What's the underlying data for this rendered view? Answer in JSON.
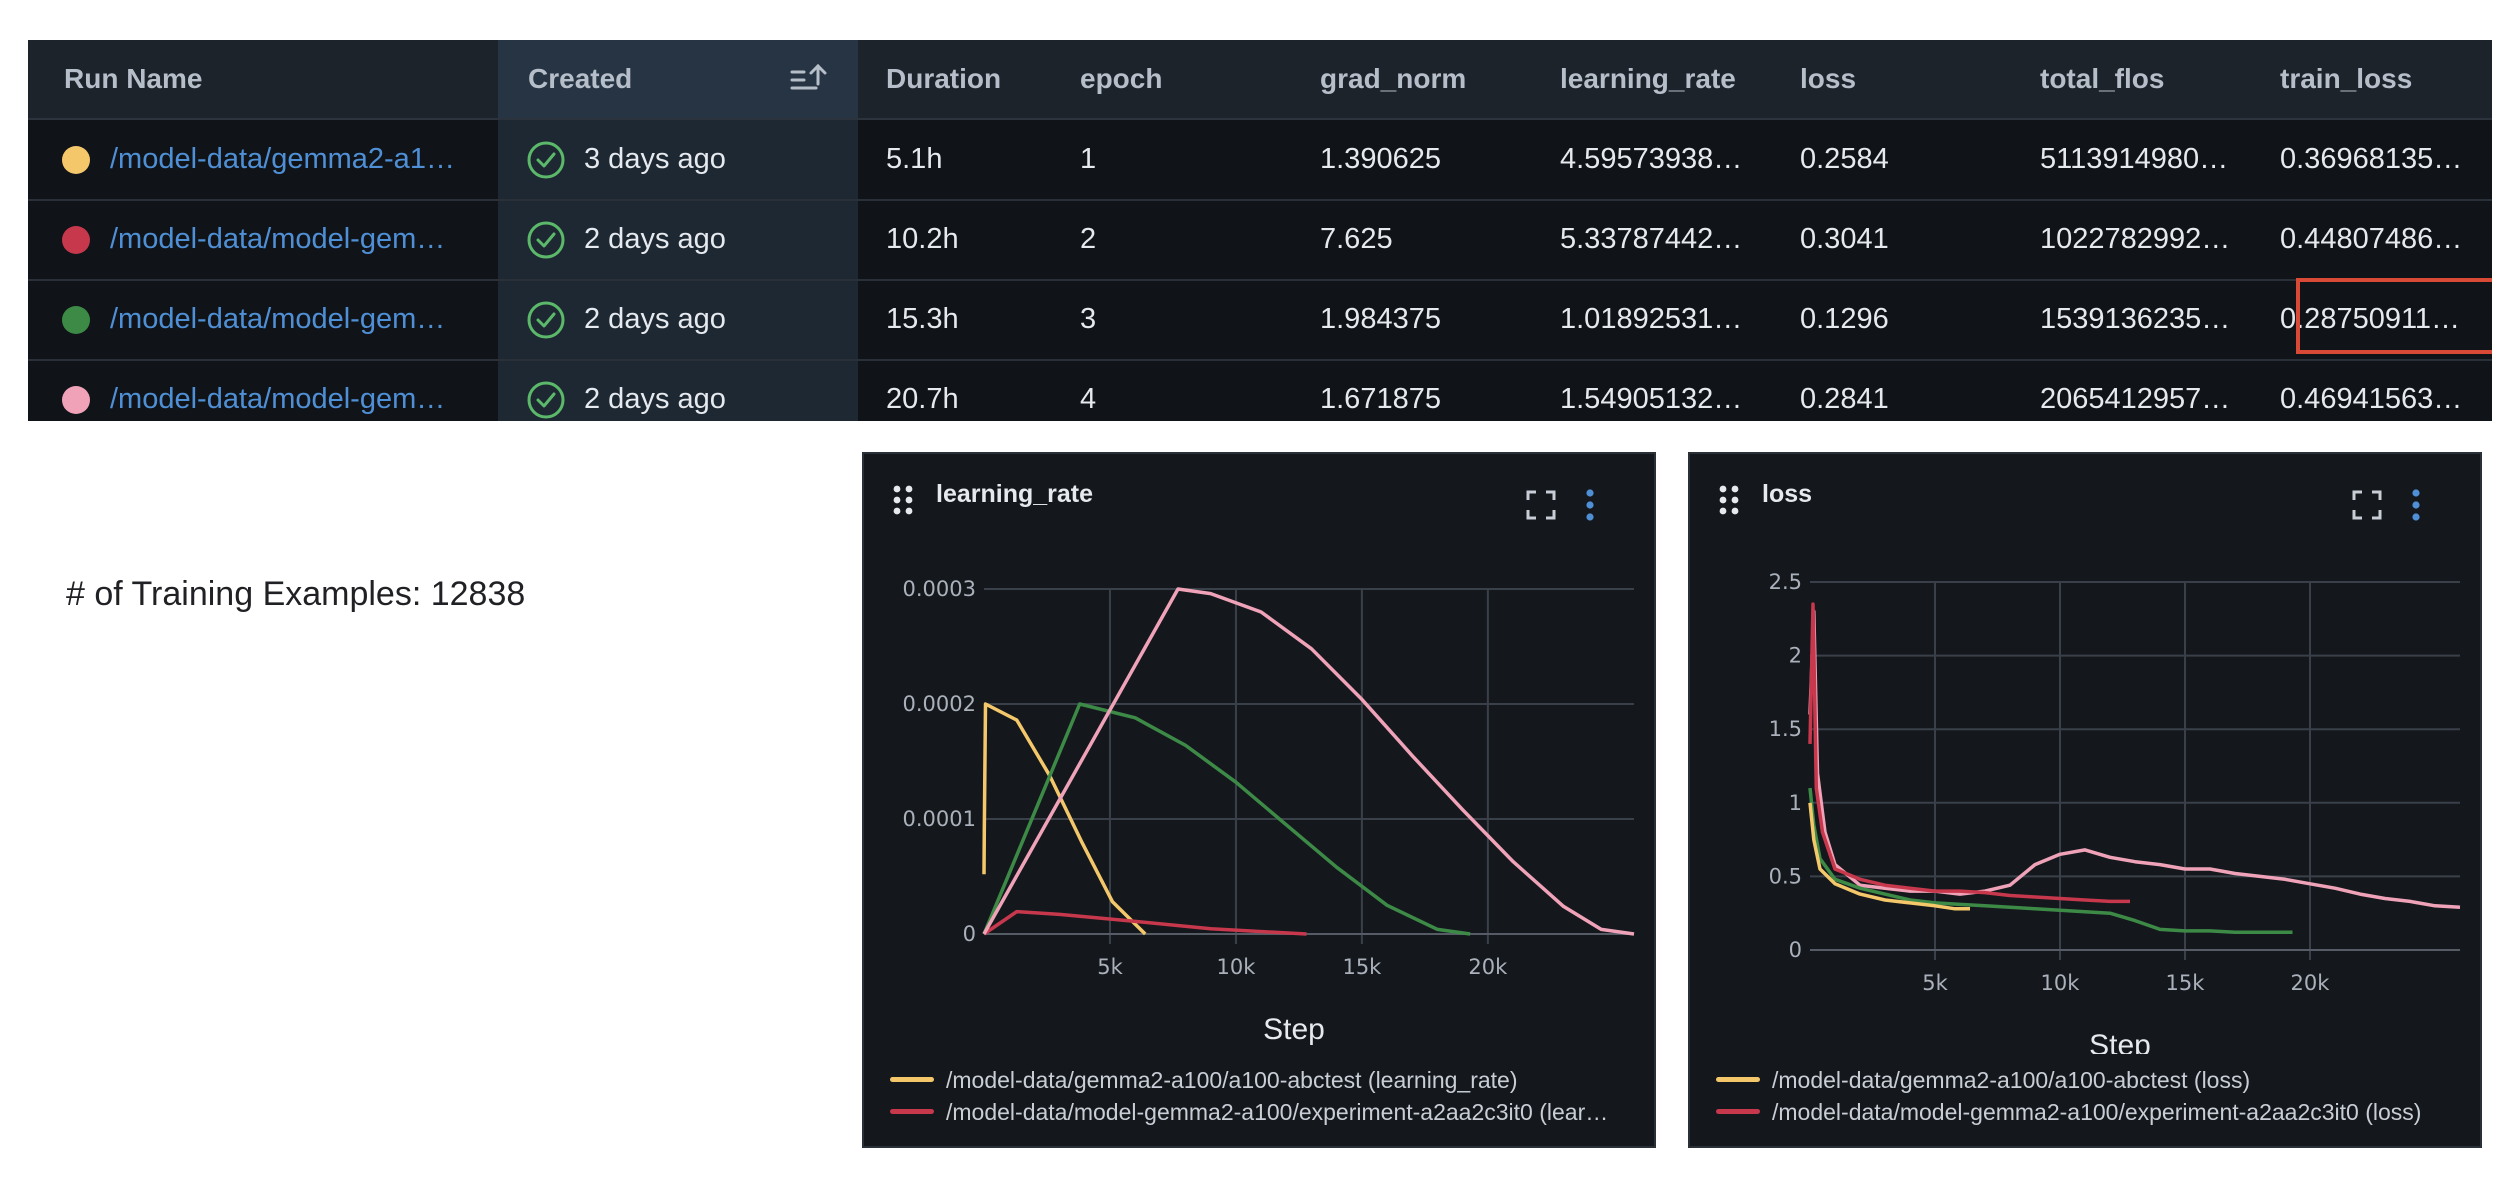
{
  "table": {
    "columns": [
      "Run Name",
      "Created",
      "Duration",
      "epoch",
      "grad_norm",
      "learning_rate",
      "loss",
      "total_flos",
      "train_loss"
    ],
    "rows": [
      {
        "run_name": "/model-data/gemma2-a10…",
        "color": "#f4c86a",
        "created": "3 days ago",
        "duration": "5.1h",
        "epoch": "1",
        "grad_norm": "1.390625",
        "learning_rate": "4.59573938…",
        "loss": "0.2584",
        "total_flos": "5113914980…",
        "train_loss": "0.36968135…"
      },
      {
        "run_name": "/model-data/model-gemm…",
        "color": "#c7384c",
        "created": "2 days ago",
        "duration": "10.2h",
        "epoch": "2",
        "grad_norm": "7.625",
        "learning_rate": "5.33787442…",
        "loss": "0.3041",
        "total_flos": "1022782992…",
        "train_loss": "0.44807486…"
      },
      {
        "run_name": "/model-data/model-gemm…",
        "color": "#3d8a47",
        "created": "2 days ago",
        "duration": "15.3h",
        "epoch": "3",
        "grad_norm": "1.984375",
        "learning_rate": "1.01892531…",
        "loss": "0.1296",
        "total_flos": "1539136235…",
        "train_loss": "0.28750911…"
      },
      {
        "run_name": "/model-data/model-gemm…",
        "color": "#f0a3b8",
        "created": "2 days ago",
        "duration": "20.7h",
        "epoch": "4",
        "grad_norm": "1.671875",
        "learning_rate": "1.54905132…",
        "loss": "0.2841",
        "total_flos": "2065412957…",
        "train_loss": "0.46941563…"
      }
    ]
  },
  "note": "# of Training Examples: 12838",
  "icons": {
    "sort": "sort-ascending-icon",
    "status": "check-circle-icon",
    "drag": "drag-handle-icon",
    "expand": "fullscreen-icon",
    "menu": "more-vert-icon"
  },
  "colors": {
    "highlight": "#d84a36",
    "link": "#4f8fd6",
    "accent_menu": "#4f8fd6"
  },
  "chart_data": [
    {
      "type": "line",
      "title": "learning_rate",
      "xlabel": "Step",
      "ylabel": "",
      "xlim": [
        0,
        25800
      ],
      "ylim": [
        0,
        0.0003
      ],
      "xticks": [
        {
          "v": 5000,
          "label": "5k"
        },
        {
          "v": 10000,
          "label": "10k"
        },
        {
          "v": 15000,
          "label": "15k"
        },
        {
          "v": 20000,
          "label": "20k"
        }
      ],
      "yticks": [
        {
          "v": 0,
          "label": "0"
        },
        {
          "v": 0.0001,
          "label": "0.0001"
        },
        {
          "v": 0.0002,
          "label": "0.0002"
        },
        {
          "v": 0.0003,
          "label": "0.0003"
        }
      ],
      "grid": true,
      "legend_position": "bottom",
      "series": [
        {
          "color": "#f4c86a",
          "x": [
            0,
            10,
            60,
            1300,
            2600,
            3900,
            5100,
            6400
          ],
          "y": [
            5.2e-05,
            9e-05,
            0.0002,
            0.000186,
            0.000138,
            7.9e-05,
            2.8e-05,
            0
          ]
        },
        {
          "color": "#c7384c",
          "x": [
            0,
            1300,
            3000,
            6000,
            9000,
            12800
          ],
          "y": [
            0,
            1.95e-05,
            1.7e-05,
            1.1e-05,
            4.5e-06,
            0
          ]
        },
        {
          "color": "#3d8a47",
          "x": [
            0,
            3800,
            6000,
            8000,
            10000,
            12000,
            14000,
            16000,
            18000,
            19300
          ],
          "y": [
            0,
            0.0002,
            0.000188,
            0.000164,
            0.000132,
            9.5e-05,
            5.8e-05,
            2.5e-05,
            4e-06,
            0
          ]
        },
        {
          "color": "#f0a3b8",
          "x": [
            0,
            7700,
            9000,
            11000,
            13000,
            15000,
            17000,
            19000,
            21000,
            23000,
            24500,
            25800
          ],
          "y": [
            0,
            0.0003,
            0.000296,
            0.00028,
            0.000248,
            0.000204,
            0.000155,
            0.000108,
            6.3e-05,
            2.4e-05,
            4e-06,
            0
          ]
        }
      ],
      "legend": [
        {
          "color": "#f4c86a",
          "label": "/model-data/gemma2-a100/a100-abctest (learning_rate)"
        },
        {
          "color": "#c7384c",
          "label": "/model-data/model-gemma2-a100/experiment-a2aa2c3it0 (lear…"
        }
      ]
    },
    {
      "type": "line",
      "title": "loss",
      "xlabel": "Step",
      "ylabel": "",
      "xlim": [
        0,
        26000
      ],
      "ylim": [
        0,
        2.5
      ],
      "xticks": [
        {
          "v": 5000,
          "label": "5k"
        },
        {
          "v": 10000,
          "label": "10k"
        },
        {
          "v": 15000,
          "label": "15k"
        },
        {
          "v": 20000,
          "label": "20k"
        }
      ],
      "yticks": [
        {
          "v": 0,
          "label": "0"
        },
        {
          "v": 0.5,
          "label": "0.5"
        },
        {
          "v": 1,
          "label": "1"
        },
        {
          "v": 1.5,
          "label": "1.5"
        },
        {
          "v": 2,
          "label": "2"
        },
        {
          "v": 2.5,
          "label": "2.5"
        }
      ],
      "grid": true,
      "legend_position": "bottom",
      "series": [
        {
          "color": "#f0a3b8",
          "x": [
            0,
            150,
            300,
            600,
            1000,
            2000,
            3000,
            4000,
            5000,
            6000,
            7000,
            8000,
            9000,
            10000,
            11000,
            12000,
            13000,
            14000,
            15000,
            16000,
            17000,
            18000,
            19000,
            20000,
            21000,
            22000,
            23000,
            24000,
            25000,
            26000
          ],
          "y": [
            1.6,
            2.3,
            1.2,
            0.8,
            0.58,
            0.44,
            0.42,
            0.4,
            0.4,
            0.38,
            0.4,
            0.44,
            0.58,
            0.65,
            0.68,
            0.63,
            0.6,
            0.58,
            0.55,
            0.55,
            0.52,
            0.5,
            0.48,
            0.45,
            0.42,
            0.38,
            0.35,
            0.33,
            0.3,
            0.29
          ]
        },
        {
          "color": "#c7384c",
          "x": [
            0,
            120,
            250,
            500,
            1000,
            2000,
            3000,
            4000,
            5000,
            6000,
            7000,
            8000,
            9000,
            10000,
            11000,
            12000,
            12800
          ],
          "y": [
            1.4,
            2.35,
            1.1,
            0.8,
            0.55,
            0.48,
            0.44,
            0.42,
            0.4,
            0.4,
            0.39,
            0.37,
            0.36,
            0.35,
            0.34,
            0.33,
            0.33
          ]
        },
        {
          "color": "#3d8a47",
          "x": [
            0,
            150,
            400,
            1000,
            2000,
            3000,
            4000,
            5000,
            6000,
            7000,
            8000,
            9000,
            10000,
            11000,
            12000,
            13000,
            14000,
            15000,
            16000,
            17000,
            18000,
            19300
          ],
          "y": [
            1.1,
            0.85,
            0.62,
            0.48,
            0.42,
            0.38,
            0.34,
            0.32,
            0.31,
            0.3,
            0.29,
            0.28,
            0.27,
            0.26,
            0.25,
            0.2,
            0.14,
            0.13,
            0.13,
            0.12,
            0.12,
            0.12
          ]
        },
        {
          "color": "#f4c86a",
          "x": [
            0,
            150,
            400,
            1000,
            2000,
            3000,
            4000,
            5000,
            5800,
            6400
          ],
          "y": [
            1.0,
            0.75,
            0.55,
            0.45,
            0.38,
            0.34,
            0.32,
            0.3,
            0.28,
            0.28
          ]
        }
      ],
      "legend": [
        {
          "color": "#f4c86a",
          "label": "/model-data/gemma2-a100/a100-abctest (loss)"
        },
        {
          "color": "#c7384c",
          "label": "/model-data/model-gemma2-a100/experiment-a2aa2c3it0 (loss)"
        }
      ]
    }
  ]
}
